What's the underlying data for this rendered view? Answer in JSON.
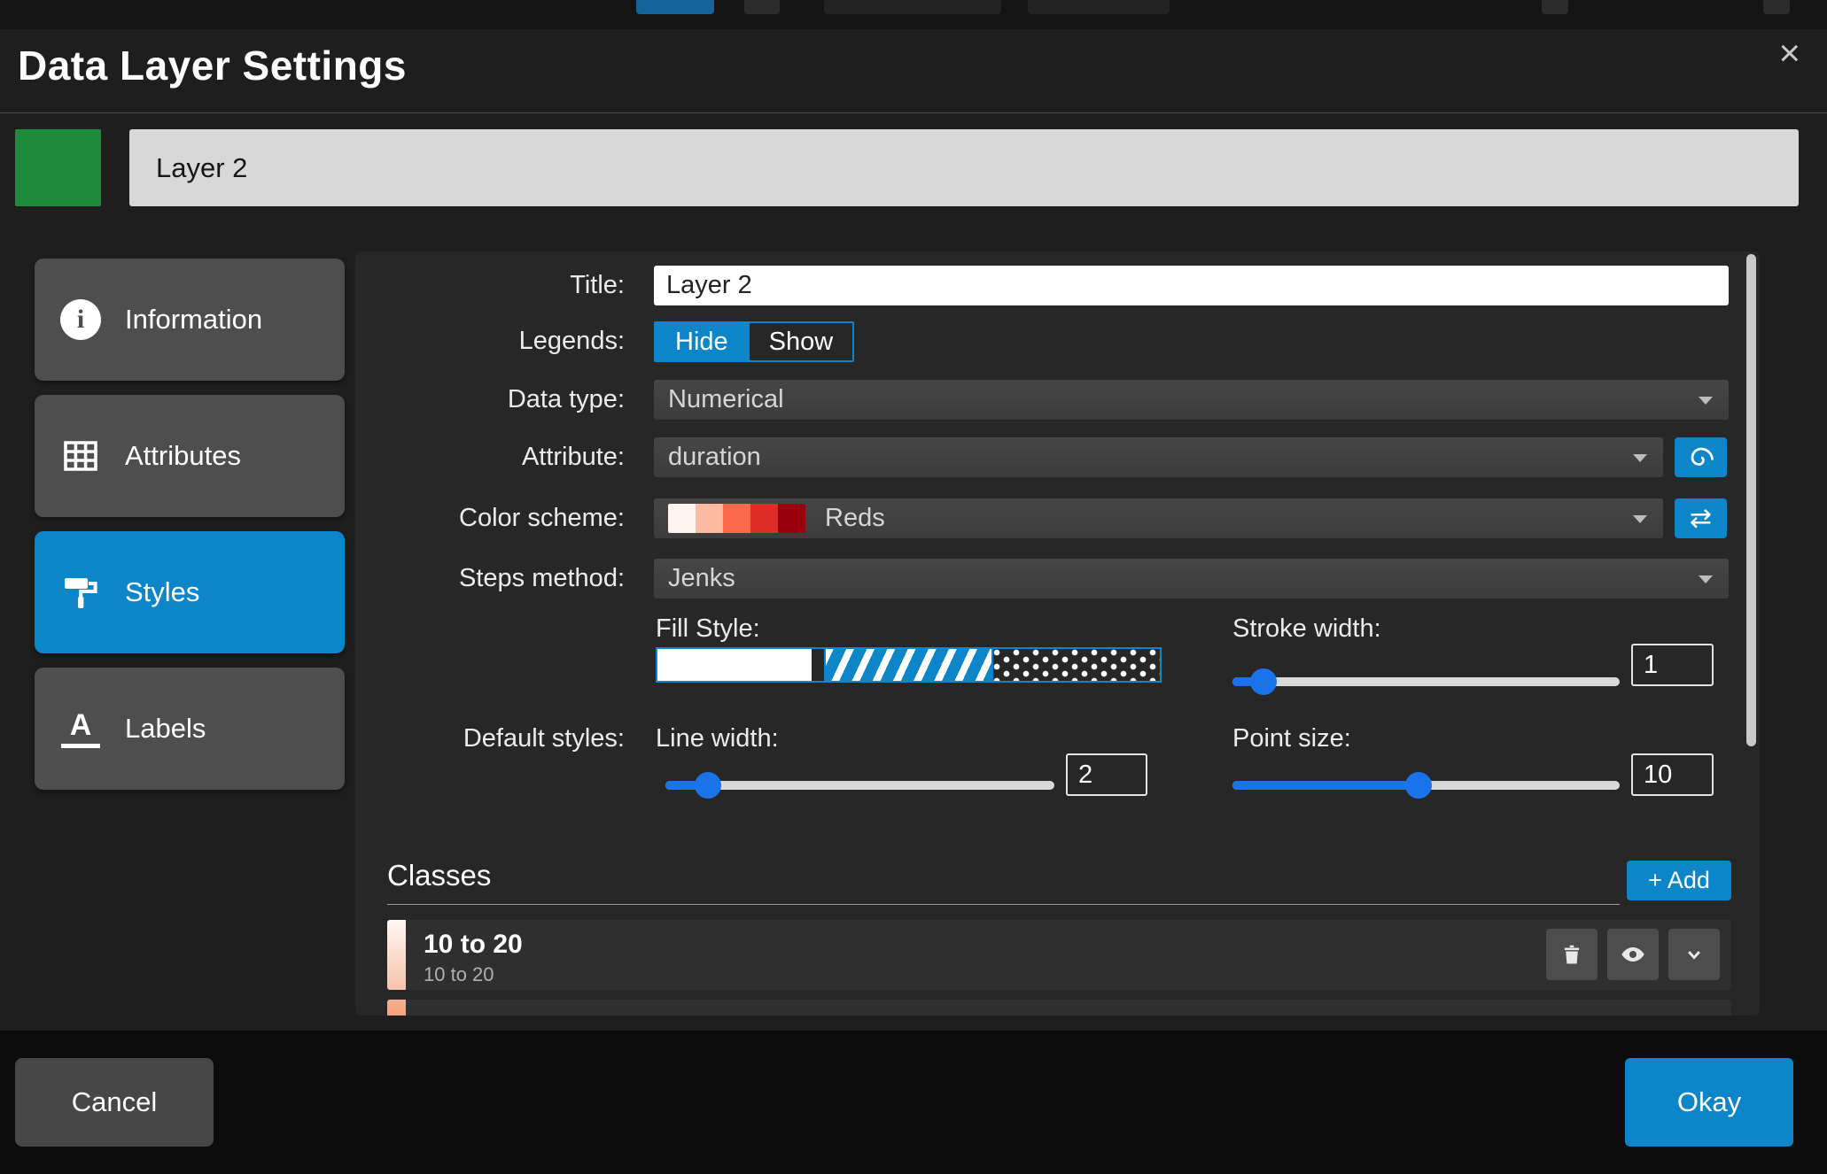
{
  "window": {
    "title": "Data Layer Settings",
    "close_icon": "×"
  },
  "layer": {
    "name": "Layer 2",
    "swatch_color": "#1e8b3c"
  },
  "sidebar": {
    "items": [
      {
        "label": "Information",
        "active": false
      },
      {
        "label": "Attributes",
        "active": false
      },
      {
        "label": "Styles",
        "active": true
      },
      {
        "label": "Labels",
        "active": false
      }
    ]
  },
  "form": {
    "title": {
      "label": "Title:",
      "value": "Layer 2"
    },
    "legends": {
      "label": "Legends:",
      "options": [
        "Hide",
        "Show"
      ],
      "selected": "Hide"
    },
    "data_type": {
      "label": "Data type:",
      "value": "Numerical"
    },
    "attribute": {
      "label": "Attribute:",
      "value": "duration"
    },
    "color_scheme": {
      "label": "Color scheme:",
      "value": "Reds",
      "swatches": [
        "#fff5f0",
        "#fcbba1",
        "#fb6a4a",
        "#de2d26",
        "#99000d"
      ]
    },
    "steps_method": {
      "label": "Steps method:",
      "value": "Jenks"
    },
    "default_styles_label": "Default styles:",
    "fill_style_label": "Fill Style:",
    "stroke_width": {
      "label": "Stroke width:",
      "value": "1"
    },
    "line_width": {
      "label": "Line width:",
      "value": "2"
    },
    "point_size": {
      "label": "Point size:",
      "value": "10"
    }
  },
  "classes": {
    "heading": "Classes",
    "add_button": "+ Add",
    "rows": [
      {
        "title": "10 to 20",
        "subtitle": "10 to 20"
      }
    ]
  },
  "footer": {
    "cancel": "Cancel",
    "okay": "Okay"
  },
  "colors": {
    "accent": "#0c86c9",
    "slider_blue": "#1a73e8",
    "layer_swatch": "#1e8b3c"
  },
  "icons": {
    "swap": "⇄"
  }
}
